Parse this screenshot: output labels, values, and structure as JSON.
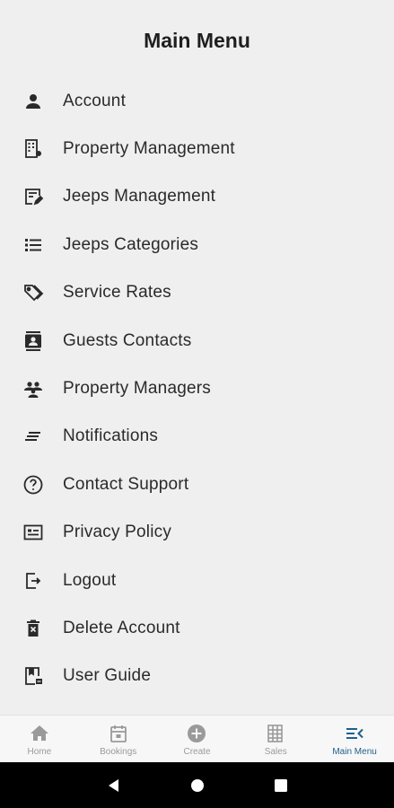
{
  "header": {
    "title": "Main Menu"
  },
  "menu": {
    "items": [
      {
        "label": "Account",
        "icon": "person-icon"
      },
      {
        "label": "Property Management",
        "icon": "building-icon"
      },
      {
        "label": "Jeeps Management",
        "icon": "edit-form-icon"
      },
      {
        "label": "Jeeps Categories",
        "icon": "list-icon"
      },
      {
        "label": "Service Rates",
        "icon": "tag-icon"
      },
      {
        "label": "Guests Contacts",
        "icon": "contacts-icon"
      },
      {
        "label": "Property Managers",
        "icon": "group-icon"
      },
      {
        "label": "Notifications",
        "icon": "notes-icon"
      },
      {
        "label": "Contact Support",
        "icon": "help-icon"
      },
      {
        "label": "Privacy Policy",
        "icon": "id-card-icon"
      },
      {
        "label": "Logout",
        "icon": "logout-icon"
      },
      {
        "label": "Delete Account",
        "icon": "trash-icon"
      },
      {
        "label": "User Guide",
        "icon": "guide-icon"
      }
    ]
  },
  "bottom_nav": {
    "items": [
      {
        "label": "Home",
        "icon": "home-icon"
      },
      {
        "label": "Bookings",
        "icon": "calendar-icon"
      },
      {
        "label": "Create",
        "icon": "add-circle-icon"
      },
      {
        "label": "Sales",
        "icon": "sales-grid-icon"
      },
      {
        "label": "Main Menu",
        "icon": "menu-icon",
        "active": true
      }
    ]
  },
  "colors": {
    "active": "#1f5f8b",
    "inactive": "#9a9a9a",
    "icon": "#2a2a2a"
  }
}
